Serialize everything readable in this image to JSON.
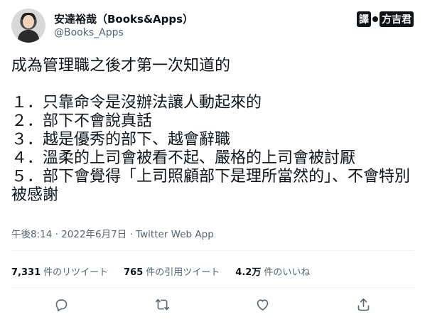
{
  "author": {
    "name": "安達裕哉（Books&Apps）",
    "handle": "@Books_Apps"
  },
  "watermark": {
    "prefix": "譯",
    "translator": "方吉君"
  },
  "tweet": {
    "text": "成為管理職之後才第一次知道的\n\n１．只靠命令是沒辦法讓人動起來的\n２．部下不會說真話\n３．越是優秀的部下、越會辭職\n４．溫柔的上司會被看不起、嚴格的上司會被討厭\n５．部下會覺得「上司照顧部下是理所當然的」、不會特別被感謝"
  },
  "meta": {
    "time": "午後8:14",
    "separator1": " · ",
    "date": "2022年6月7日",
    "separator2": " · ",
    "client": "Twitter Web App"
  },
  "stats": {
    "retweets_count": "7,331",
    "retweets_label": "件のリツイート",
    "quotes_count": "765",
    "quotes_label": "件の引用ツイート",
    "likes_count": "4.2万",
    "likes_label": "件のいいね"
  },
  "actions": {
    "reply_icon": "reply-icon",
    "retweet_icon": "retweet-icon",
    "like_icon": "heart-icon",
    "share_icon": "share-icon"
  }
}
